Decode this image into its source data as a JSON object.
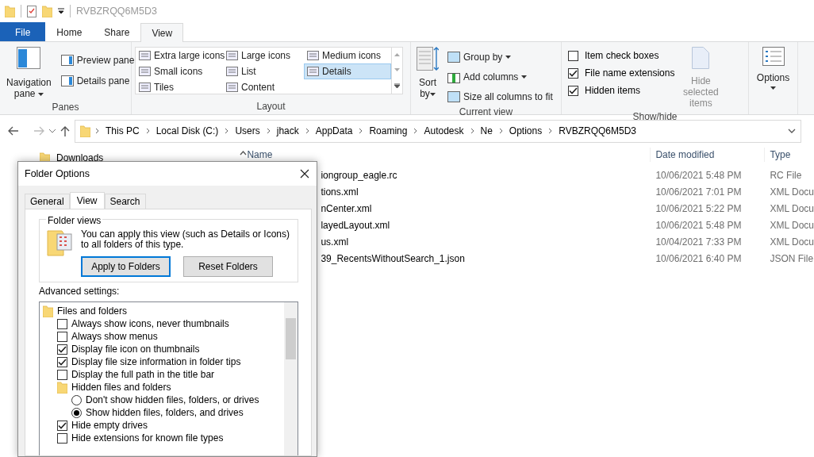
{
  "title_bar": {
    "title": "RVBZRQQ6M5D3"
  },
  "ribbon_tabs": [
    {
      "label": "File",
      "kind": "file",
      "selected": false
    },
    {
      "label": "Home",
      "kind": "tab",
      "selected": false
    },
    {
      "label": "Share",
      "kind": "tab",
      "selected": false
    },
    {
      "label": "View",
      "kind": "tab",
      "selected": true
    }
  ],
  "ribbon": {
    "panes": {
      "label": "Panes",
      "navigation_pane": "Navigation pane",
      "items": [
        "Preview pane",
        "Details pane"
      ]
    },
    "layout": {
      "label": "Layout",
      "items": [
        {
          "label": "Extra large icons",
          "selected": false
        },
        {
          "label": "Large icons",
          "selected": false
        },
        {
          "label": "Medium icons",
          "selected": false
        },
        {
          "label": "Small icons",
          "selected": false
        },
        {
          "label": "List",
          "selected": false
        },
        {
          "label": "Details",
          "selected": true
        },
        {
          "label": "Tiles",
          "selected": false
        },
        {
          "label": "Content",
          "selected": false
        }
      ]
    },
    "current_view": {
      "label": "Current view",
      "sort_by": "Sort by",
      "items": [
        {
          "label": "Group by",
          "dropdown": true
        },
        {
          "label": "Add columns",
          "dropdown": true
        },
        {
          "label": "Size all columns to fit",
          "dropdown": false
        }
      ]
    },
    "show_hide": {
      "label": "Show/hide",
      "checkboxes": [
        {
          "label": "Item check boxes",
          "checked": false
        },
        {
          "label": "File name extensions",
          "checked": true
        },
        {
          "label": "Hidden items",
          "checked": true
        }
      ],
      "hide_selected": {
        "label": "Hide selected items",
        "disabled": true
      }
    },
    "options": {
      "label": "Options"
    }
  },
  "address_bar": {
    "breadcrumbs": [
      "This PC",
      "Local Disk (C:)",
      "Users",
      "jhack",
      "AppData",
      "Roaming",
      "Autodesk",
      "Ne",
      "Options",
      "RVBZRQQ6M5D3"
    ]
  },
  "nav_pane": {
    "items": [
      "Downloads"
    ]
  },
  "file_list": {
    "columns": [
      "Name",
      "Date modified",
      "Type"
    ],
    "rows": [
      {
        "name": "iongroup_eagle.rc",
        "date": "10/06/2021 5:48 PM",
        "type": "RC File"
      },
      {
        "name": "tions.xml",
        "date": "10/06/2021 7:01 PM",
        "type": "XML Docu"
      },
      {
        "name": "nCenter.xml",
        "date": "10/06/2021 5:22 PM",
        "type": "XML Docu"
      },
      {
        "name": "layedLayout.xml",
        "date": "10/06/2021 5:48 PM",
        "type": "XML Docu"
      },
      {
        "name": "us.xml",
        "date": "10/04/2021 7:33 PM",
        "type": "XML Docu"
      },
      {
        "name": "39_RecentsWithoutSearch_1.json",
        "date": "10/06/2021 6:40 PM",
        "type": "JSON File"
      }
    ]
  },
  "dialog": {
    "title": "Folder Options",
    "tabs": [
      {
        "label": "General",
        "selected": false
      },
      {
        "label": "View",
        "selected": true
      },
      {
        "label": "Search",
        "selected": false
      }
    ],
    "folder_views": {
      "label": "Folder views",
      "text": "You can apply this view (such as Details or Icons) to all folders of this type.",
      "buttons": [
        {
          "label": "Apply to Folders",
          "focused": true
        },
        {
          "label": "Reset Folders",
          "focused": false
        }
      ]
    },
    "advanced_label": "Advanced settings:",
    "settings": [
      {
        "kind": "folder",
        "label": "Files and folders",
        "children": [
          {
            "kind": "checkbox",
            "label": "Always show icons, never thumbnails",
            "checked": false
          },
          {
            "kind": "checkbox",
            "label": "Always show menus",
            "checked": false
          },
          {
            "kind": "checkbox",
            "label": "Display file icon on thumbnails",
            "checked": true
          },
          {
            "kind": "checkbox",
            "label": "Display file size information in folder tips",
            "checked": true
          },
          {
            "kind": "checkbox",
            "label": "Display the full path in the title bar",
            "checked": false
          },
          {
            "kind": "folder",
            "label": "Hidden files and folders",
            "children": [
              {
                "kind": "radio",
                "label": "Don't show hidden files, folders, or drives",
                "selected": false
              },
              {
                "kind": "radio",
                "label": "Show hidden files, folders, and drives",
                "selected": true
              }
            ]
          },
          {
            "kind": "checkbox",
            "label": "Hide empty drives",
            "checked": true
          },
          {
            "kind": "checkbox",
            "label": "Hide extensions for known file types",
            "checked": false
          }
        ]
      }
    ]
  }
}
